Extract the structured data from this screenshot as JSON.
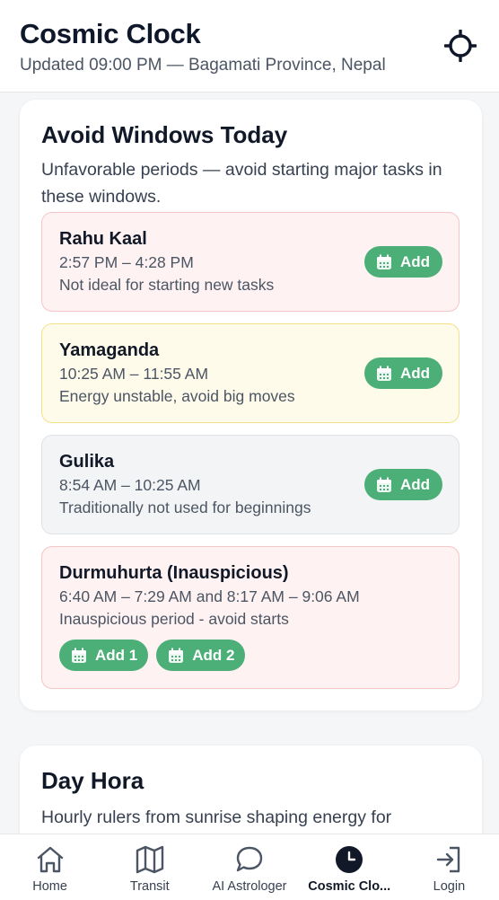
{
  "header": {
    "title": "Cosmic Clock",
    "subtitle": "Updated 09:00 PM — Bagamati Province, Nepal",
    "locate_icon": "crosshair-icon"
  },
  "avoid": {
    "title": "Avoid Windows Today",
    "description": "Unfavorable periods — avoid starting major tasks in these windows.",
    "windows": [
      {
        "name": "Rahu Kaal",
        "time": "2:57 PM – 4:28 PM",
        "note": "Not ideal for starting new tasks",
        "tone": "red",
        "button": "Add"
      },
      {
        "name": "Yamaganda",
        "time": "10:25 AM – 11:55 AM",
        "note": "Energy unstable, avoid big moves",
        "tone": "yellow",
        "button": "Add"
      },
      {
        "name": "Gulika",
        "time": "8:54 AM – 10:25 AM",
        "note": "Traditionally not used for beginnings",
        "tone": "gray",
        "button": "Add"
      },
      {
        "name": "Durmuhurta (Inauspicious)",
        "time": "6:40 AM – 7:29 AM and 8:17 AM – 9:06 AM",
        "note": "Inauspicious period - avoid starts",
        "tone": "red",
        "buttons": [
          "Add 1",
          "Add 2"
        ]
      }
    ]
  },
  "hora": {
    "title": "Day Hora",
    "description": "Hourly rulers from sunrise shaping energy for"
  },
  "nav": {
    "items": [
      {
        "label": "Home",
        "icon": "home-icon"
      },
      {
        "label": "Transit",
        "icon": "map-icon"
      },
      {
        "label": "AI Astrologer",
        "icon": "chat-bubble-icon"
      },
      {
        "label": "Cosmic Clo...",
        "icon": "clock-icon",
        "active": true
      },
      {
        "label": "Login",
        "icon": "login-icon"
      }
    ]
  },
  "colors": {
    "accent_green": "#4caf78",
    "red_bg": "#fef2f2",
    "yellow_bg": "#fffbea",
    "gray_bg": "#f3f4f6"
  }
}
